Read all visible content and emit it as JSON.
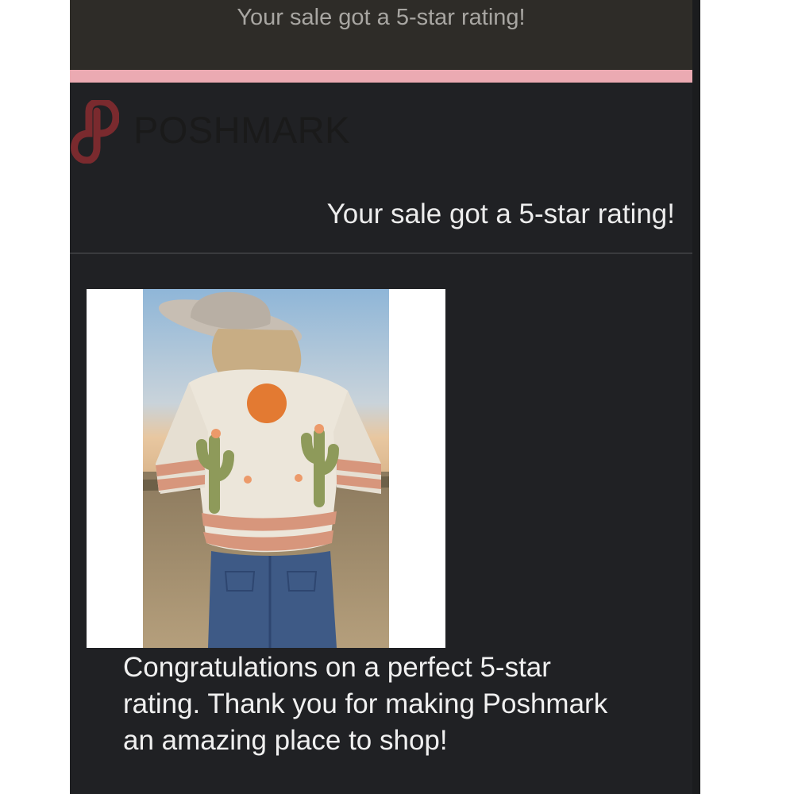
{
  "preheader": "Your sale got a 5-star rating!",
  "brand": {
    "name": "POSHMARK",
    "logo_icon": "poshmark-logo-icon",
    "accent_color": "#ebaab2",
    "logo_color": "#7a2a2e"
  },
  "headline": "Your sale got a 5-star rating!",
  "product": {
    "image_icon": "product-photo-cactus-sweater"
  },
  "message": "Congratulations on a perfect 5-star rating. Thank you for making Poshmark an amazing place to shop!"
}
